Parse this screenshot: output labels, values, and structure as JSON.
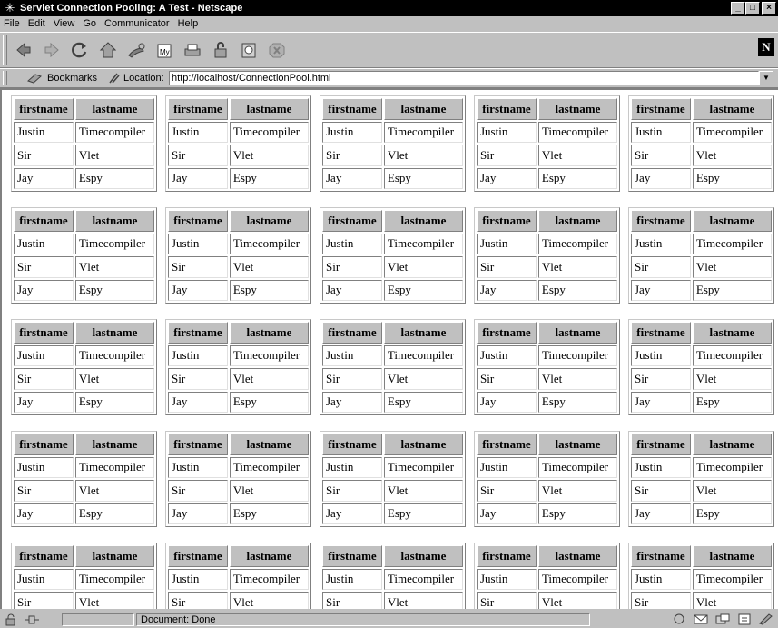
{
  "window": {
    "title": "Servlet Connection Pooling: A Test - Netscape",
    "minimize": "_",
    "maximize": "□",
    "close": "×"
  },
  "menu": [
    "File",
    "Edit",
    "View",
    "Go",
    "Communicator",
    "Help"
  ],
  "toolbar": {
    "buttons": [
      "back-icon",
      "forward-icon",
      "reload-icon",
      "home-icon",
      "search-icon",
      "netscape-guide-icon",
      "print-icon",
      "security-icon",
      "shop-icon",
      "stop-icon"
    ],
    "logo": "N"
  },
  "location": {
    "bookmarks_label": "Bookmarks",
    "location_label": "Location:",
    "url": "http://localhost/ConnectionPool.html"
  },
  "table": {
    "headers": [
      "firstname",
      "lastname"
    ],
    "rows": [
      [
        "Justin",
        "Timecompiler"
      ],
      [
        "Sir",
        "Vlet"
      ],
      [
        "Jay",
        "Espy"
      ]
    ],
    "grid_rows": 5,
    "grid_cols": 5
  },
  "status": {
    "text": "Document: Done"
  }
}
